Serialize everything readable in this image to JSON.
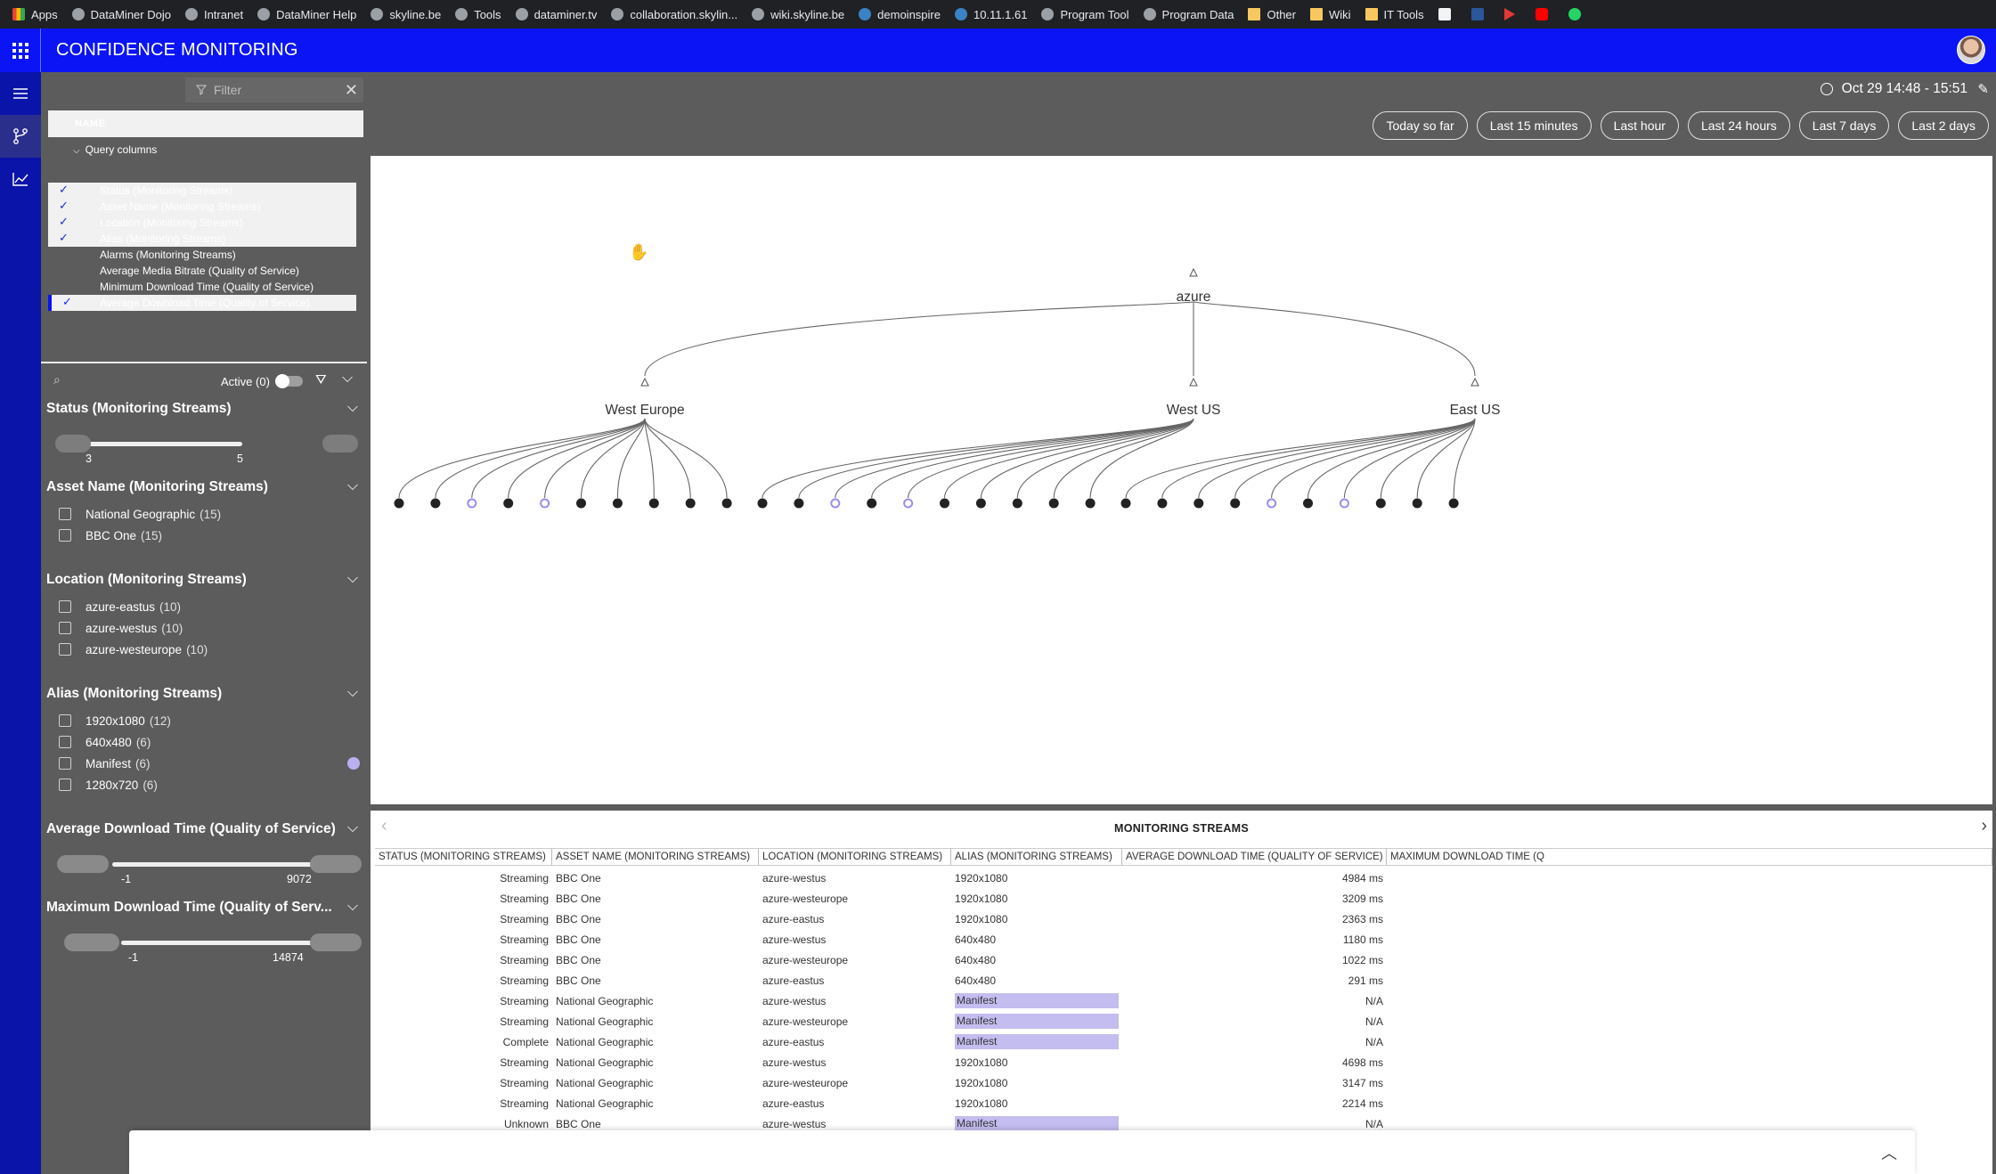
{
  "bookmarks": [
    {
      "label": "Apps",
      "icon": "apps"
    },
    {
      "label": "DataMiner Dojo",
      "icon": "plain"
    },
    {
      "label": "Intranet",
      "icon": "plain"
    },
    {
      "label": "DataMiner Help",
      "icon": "plain"
    },
    {
      "label": "skyline.be",
      "icon": "plain"
    },
    {
      "label": "Tools",
      "icon": "plain"
    },
    {
      "label": "dataminer.tv",
      "icon": "plain"
    },
    {
      "label": "collaboration.skylin...",
      "icon": "plain"
    },
    {
      "label": "wiki.skyline.be",
      "icon": "plain"
    },
    {
      "label": "demoinspire",
      "icon": "ms"
    },
    {
      "label": "10.11.1.61",
      "icon": "ms"
    },
    {
      "label": "Program Tool",
      "icon": "plain"
    },
    {
      "label": "Program Data",
      "icon": "plain"
    },
    {
      "label": "Other",
      "icon": "folder"
    },
    {
      "label": "Wiki",
      "icon": "folder"
    },
    {
      "label": "IT Tools",
      "icon": "folder"
    },
    {
      "label": "",
      "icon": "bk"
    },
    {
      "label": "",
      "icon": "word"
    },
    {
      "label": "",
      "icon": "play"
    },
    {
      "label": "",
      "icon": "yt"
    },
    {
      "label": "",
      "icon": "wa"
    }
  ],
  "app": {
    "title": "CONFIDENCE MONITORING"
  },
  "panel": {
    "filter_placeholder": "Filter",
    "name_header": "NAME",
    "query_columns_label": "Query columns",
    "query_columns": [
      {
        "label": "Status (Monitoring Streams)",
        "selected": true
      },
      {
        "label": "Asset Name (Monitoring Streams)",
        "selected": true
      },
      {
        "label": "Location (Monitoring Streams)",
        "selected": true
      },
      {
        "label": "Alias (Monitoring Streams)",
        "selected": true
      },
      {
        "label": "Alarms (Monitoring Streams)",
        "selected": false
      },
      {
        "label": "Average Media Bitrate (Quality of Service)",
        "selected": false
      },
      {
        "label": "Minimum Download Time (Quality of Service)",
        "selected": false
      },
      {
        "label": "Average Download Time (Quality of Service)",
        "selected": true
      }
    ],
    "active_label": "Active (0)",
    "status": {
      "title": "Status (Monitoring Streams)",
      "min": "3",
      "max": "5"
    },
    "asset": {
      "title": "Asset Name (Monitoring Streams)",
      "options": [
        {
          "label": "National Geographic",
          "count": "(15)"
        },
        {
          "label": "BBC One",
          "count": "(15)"
        }
      ]
    },
    "location": {
      "title": "Location (Monitoring Streams)",
      "options": [
        {
          "label": "azure-eastus",
          "count": "(10)"
        },
        {
          "label": "azure-westus",
          "count": "(10)"
        },
        {
          "label": "azure-westeurope",
          "count": "(10)"
        }
      ]
    },
    "alias": {
      "title": "Alias (Monitoring Streams)",
      "options": [
        {
          "label": "1920x1080",
          "count": "(12)"
        },
        {
          "label": "640x480",
          "count": "(6)"
        },
        {
          "label": "Manifest",
          "count": "(6)"
        },
        {
          "label": "1280x720",
          "count": "(6)"
        }
      ],
      "manifest_color": "#b9b0f0"
    },
    "avg_dl": {
      "title": "Average Download Time (Quality of Service)",
      "min": "-1",
      "max": "9072"
    },
    "max_dl": {
      "title": "Maximum Download Time (Quality of Serv...",
      "min": "-1",
      "max": "14874"
    }
  },
  "main": {
    "time_range": "Oct 29 14:48 - 15:51",
    "quick_ranges": [
      "Today so far",
      "Last 15 minutes",
      "Last hour",
      "Last 24 hours",
      "Last 7 days",
      "Last 2 days"
    ]
  },
  "topology": {
    "root": "azure",
    "regions": [
      "West Europe",
      "West US",
      "East US"
    ],
    "leaves_per_region": 10,
    "highlighted_leaves": [
      [
        2,
        4
      ],
      [
        2,
        4
      ],
      [
        4,
        6
      ]
    ],
    "highlight_color": "#9c8cf0"
  },
  "table": {
    "title": "MONITORING STREAMS",
    "columns": [
      "STATUS (MONITORING STREAMS)",
      "ASSET NAME (MONITORING STREAMS)",
      "LOCATION (MONITORING STREAMS)",
      "ALIAS (MONITORING STREAMS)",
      "AVERAGE DOWNLOAD TIME (QUALITY OF SERVICE)",
      "MAXIMUM DOWNLOAD TIME (Q"
    ],
    "rows": [
      [
        "Streaming",
        "BBC One",
        "azure-westus",
        "1920x1080",
        "4984 ms"
      ],
      [
        "Streaming",
        "BBC One",
        "azure-westeurope",
        "1920x1080",
        "3209 ms"
      ],
      [
        "Streaming",
        "BBC One",
        "azure-eastus",
        "1920x1080",
        "2363 ms"
      ],
      [
        "Streaming",
        "BBC One",
        "azure-westus",
        "640x480",
        "1180 ms"
      ],
      [
        "Streaming",
        "BBC One",
        "azure-westeurope",
        "640x480",
        "1022 ms"
      ],
      [
        "Streaming",
        "BBC One",
        "azure-eastus",
        "640x480",
        "291 ms"
      ],
      [
        "Streaming",
        "National Geographic",
        "azure-westus",
        "Manifest",
        "N/A"
      ],
      [
        "Streaming",
        "National Geographic",
        "azure-westeurope",
        "Manifest",
        "N/A"
      ],
      [
        "Complete",
        "National Geographic",
        "azure-eastus",
        "Manifest",
        "N/A"
      ],
      [
        "Streaming",
        "National Geographic",
        "azure-westus",
        "1920x1080",
        "4698 ms"
      ],
      [
        "Streaming",
        "National Geographic",
        "azure-westeurope",
        "1920x1080",
        "3147 ms"
      ],
      [
        "Streaming",
        "National Geographic",
        "azure-eastus",
        "1920x1080",
        "2214 ms"
      ],
      [
        "Unknown",
        "BBC One",
        "azure-westus",
        "Manifest",
        "N/A"
      ]
    ]
  }
}
